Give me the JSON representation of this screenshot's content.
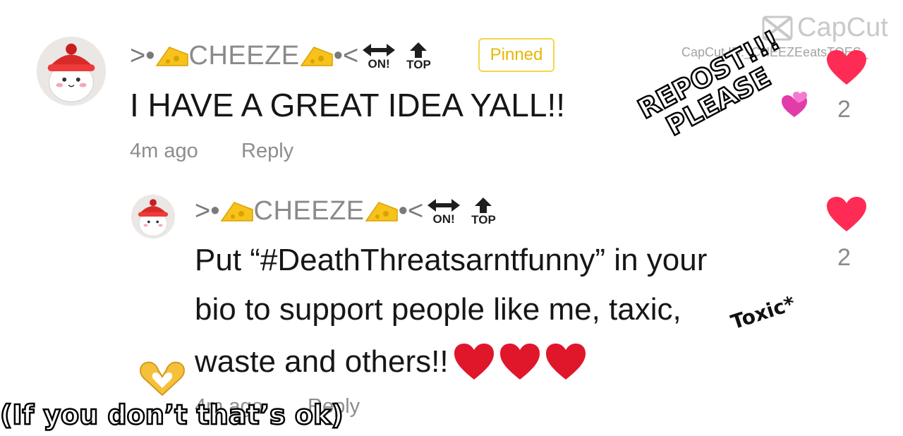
{
  "watermark": {
    "logo_text": "CapCut",
    "id_text": "CapCut ID:_CHEEZEeatsTOES_"
  },
  "comment": {
    "username": ">•🧀CHEEZE🧀•<",
    "name_text": "CHEEZE",
    "prefix": ">•",
    "suffix": "•<",
    "badge_on": "ON!",
    "badge_top": "TOP",
    "pinned_label": "Pinned",
    "text": "I HAVE A GREAT IDEA YALL!!",
    "time": "4m ago",
    "reply_label": "Reply",
    "like_count": "2"
  },
  "reply": {
    "name_text": "CHEEZE",
    "prefix": ">•",
    "suffix": "•<",
    "badge_on": "ON!",
    "badge_top": "TOP",
    "text_line1": "Put “#DeathThreatsarntfunny” in your",
    "text_line2": "bio to support people like me, taxic,",
    "text_line3": "waste and others!!",
    "time": "4m ago",
    "reply_label": "Reply",
    "like_count": "2"
  },
  "overlay": {
    "sticker_line1": "REPOST!!!",
    "sticker_line2": "PLEASE",
    "correction": "Toxic*",
    "caption": "(If you don’t that’s ok)"
  },
  "colors": {
    "heart": "#fe2c55",
    "pinned": "#f5d54a",
    "meta": "#8d8d8d"
  }
}
